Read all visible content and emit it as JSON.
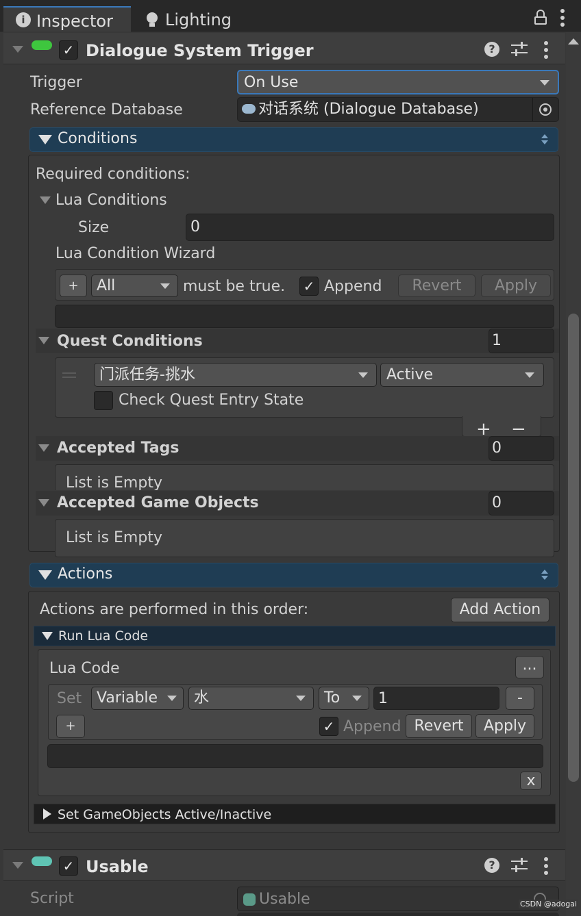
{
  "tabs": [
    {
      "label": "Inspector"
    },
    {
      "label": "Lighting"
    }
  ],
  "dst": {
    "title": "Dialogue System Trigger",
    "trigger_label": "Trigger",
    "trigger_value": "On Use",
    "refdb_label": "Reference Database",
    "refdb_value": "对话系统 (Dialogue Database)"
  },
  "conditions": {
    "header": "Conditions",
    "required": "Required conditions:",
    "lua_conditions": "Lua Conditions",
    "size_label": "Size",
    "size_value": "0",
    "wizard_label": "Lua Condition Wizard",
    "plus": "+",
    "all_value": "All",
    "must_be_true": "must be true.",
    "append": "Append",
    "revert": "Revert",
    "apply": "Apply",
    "quest_conditions": "Quest Conditions",
    "quest_count": "1",
    "quest_name": "门派任务-挑水",
    "quest_state": "Active",
    "check_entry": "Check Quest Entry State",
    "list_plus": "+",
    "list_minus": "−",
    "accepted_tags": "Accepted Tags",
    "tags_count": "0",
    "tags_empty": "List is Empty",
    "accepted_gos": "Accepted Game Objects",
    "gos_count": "0",
    "gos_empty": "List is Empty"
  },
  "actions": {
    "header": "Actions",
    "order_text": "Actions are performed in this order:",
    "add_action": "Add Action",
    "run_lua": "Run Lua Code",
    "lua_code_label": "Lua Code",
    "ellipsis": "...",
    "set_label": "Set",
    "variable_value": "Variable",
    "var_name": "水",
    "to_value": "To",
    "assign_value": "1",
    "minus": "-",
    "plus": "+",
    "append": "Append",
    "revert": "Revert",
    "apply": "Apply",
    "close_x": "x",
    "set_gameobjects": "Set GameObjects Active/Inactive"
  },
  "usable": {
    "title": "Usable",
    "script_label": "Script",
    "script_value": "Usable"
  },
  "watermark": "CSDN @adogai"
}
